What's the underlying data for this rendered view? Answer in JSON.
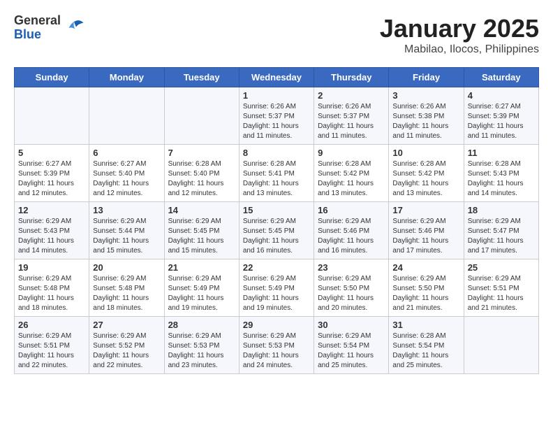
{
  "header": {
    "logo": {
      "general": "General",
      "blue": "Blue"
    },
    "title": "January 2025",
    "subtitle": "Mabilao, Ilocos, Philippines"
  },
  "weekdays": [
    "Sunday",
    "Monday",
    "Tuesday",
    "Wednesday",
    "Thursday",
    "Friday",
    "Saturday"
  ],
  "weeks": [
    [
      {
        "day": null,
        "sunrise": null,
        "sunset": null,
        "daylight": null
      },
      {
        "day": null,
        "sunrise": null,
        "sunset": null,
        "daylight": null
      },
      {
        "day": null,
        "sunrise": null,
        "sunset": null,
        "daylight": null
      },
      {
        "day": 1,
        "sunrise": "6:26 AM",
        "sunset": "5:37 PM",
        "daylight": "11 hours and 11 minutes."
      },
      {
        "day": 2,
        "sunrise": "6:26 AM",
        "sunset": "5:37 PM",
        "daylight": "11 hours and 11 minutes."
      },
      {
        "day": 3,
        "sunrise": "6:26 AM",
        "sunset": "5:38 PM",
        "daylight": "11 hours and 11 minutes."
      },
      {
        "day": 4,
        "sunrise": "6:27 AM",
        "sunset": "5:39 PM",
        "daylight": "11 hours and 11 minutes."
      }
    ],
    [
      {
        "day": 5,
        "sunrise": "6:27 AM",
        "sunset": "5:39 PM",
        "daylight": "11 hours and 12 minutes."
      },
      {
        "day": 6,
        "sunrise": "6:27 AM",
        "sunset": "5:40 PM",
        "daylight": "11 hours and 12 minutes."
      },
      {
        "day": 7,
        "sunrise": "6:28 AM",
        "sunset": "5:40 PM",
        "daylight": "11 hours and 12 minutes."
      },
      {
        "day": 8,
        "sunrise": "6:28 AM",
        "sunset": "5:41 PM",
        "daylight": "11 hours and 13 minutes."
      },
      {
        "day": 9,
        "sunrise": "6:28 AM",
        "sunset": "5:42 PM",
        "daylight": "11 hours and 13 minutes."
      },
      {
        "day": 10,
        "sunrise": "6:28 AM",
        "sunset": "5:42 PM",
        "daylight": "11 hours and 13 minutes."
      },
      {
        "day": 11,
        "sunrise": "6:28 AM",
        "sunset": "5:43 PM",
        "daylight": "11 hours and 14 minutes."
      }
    ],
    [
      {
        "day": 12,
        "sunrise": "6:29 AM",
        "sunset": "5:43 PM",
        "daylight": "11 hours and 14 minutes."
      },
      {
        "day": 13,
        "sunrise": "6:29 AM",
        "sunset": "5:44 PM",
        "daylight": "11 hours and 15 minutes."
      },
      {
        "day": 14,
        "sunrise": "6:29 AM",
        "sunset": "5:45 PM",
        "daylight": "11 hours and 15 minutes."
      },
      {
        "day": 15,
        "sunrise": "6:29 AM",
        "sunset": "5:45 PM",
        "daylight": "11 hours and 16 minutes."
      },
      {
        "day": 16,
        "sunrise": "6:29 AM",
        "sunset": "5:46 PM",
        "daylight": "11 hours and 16 minutes."
      },
      {
        "day": 17,
        "sunrise": "6:29 AM",
        "sunset": "5:46 PM",
        "daylight": "11 hours and 17 minutes."
      },
      {
        "day": 18,
        "sunrise": "6:29 AM",
        "sunset": "5:47 PM",
        "daylight": "11 hours and 17 minutes."
      }
    ],
    [
      {
        "day": 19,
        "sunrise": "6:29 AM",
        "sunset": "5:48 PM",
        "daylight": "11 hours and 18 minutes."
      },
      {
        "day": 20,
        "sunrise": "6:29 AM",
        "sunset": "5:48 PM",
        "daylight": "11 hours and 18 minutes."
      },
      {
        "day": 21,
        "sunrise": "6:29 AM",
        "sunset": "5:49 PM",
        "daylight": "11 hours and 19 minutes."
      },
      {
        "day": 22,
        "sunrise": "6:29 AM",
        "sunset": "5:49 PM",
        "daylight": "11 hours and 19 minutes."
      },
      {
        "day": 23,
        "sunrise": "6:29 AM",
        "sunset": "5:50 PM",
        "daylight": "11 hours and 20 minutes."
      },
      {
        "day": 24,
        "sunrise": "6:29 AM",
        "sunset": "5:50 PM",
        "daylight": "11 hours and 21 minutes."
      },
      {
        "day": 25,
        "sunrise": "6:29 AM",
        "sunset": "5:51 PM",
        "daylight": "11 hours and 21 minutes."
      }
    ],
    [
      {
        "day": 26,
        "sunrise": "6:29 AM",
        "sunset": "5:51 PM",
        "daylight": "11 hours and 22 minutes."
      },
      {
        "day": 27,
        "sunrise": "6:29 AM",
        "sunset": "5:52 PM",
        "daylight": "11 hours and 22 minutes."
      },
      {
        "day": 28,
        "sunrise": "6:29 AM",
        "sunset": "5:53 PM",
        "daylight": "11 hours and 23 minutes."
      },
      {
        "day": 29,
        "sunrise": "6:29 AM",
        "sunset": "5:53 PM",
        "daylight": "11 hours and 24 minutes."
      },
      {
        "day": 30,
        "sunrise": "6:29 AM",
        "sunset": "5:54 PM",
        "daylight": "11 hours and 25 minutes."
      },
      {
        "day": 31,
        "sunrise": "6:28 AM",
        "sunset": "5:54 PM",
        "daylight": "11 hours and 25 minutes."
      },
      {
        "day": null,
        "sunrise": null,
        "sunset": null,
        "daylight": null
      }
    ]
  ]
}
